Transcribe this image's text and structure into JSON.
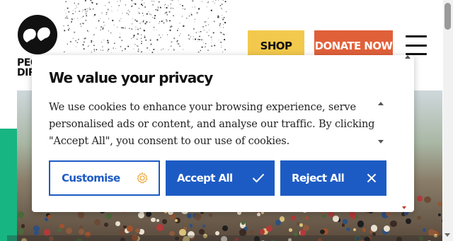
{
  "header": {
    "brand_text": "PEOPLE\nDIRECT",
    "shop_label": "SHOP",
    "donate_label": "DONATE NOW",
    "menu_icon": "hamburger-menu-icon",
    "logo_icon": "two-circles-logo-icon"
  },
  "cookie_banner": {
    "title": "We value your privacy",
    "body": "We use cookies to enhance your browsing experience, serve personalised ads or content, and analyse our traffic. By clicking \"Accept All\", you consent to our use of cookies.",
    "buttons": {
      "customise": {
        "label": "Customise",
        "icon": "gear-icon"
      },
      "accept": {
        "label": "Accept All",
        "icon": "checkmark-icon"
      },
      "reject": {
        "label": "Reject All",
        "icon": "close-icon"
      }
    }
  },
  "colors": {
    "primary_blue": "#1d5bc4",
    "shop_yellow": "#f2c94c",
    "donate_orange": "#e0603a",
    "accent_green": "#17b582"
  }
}
